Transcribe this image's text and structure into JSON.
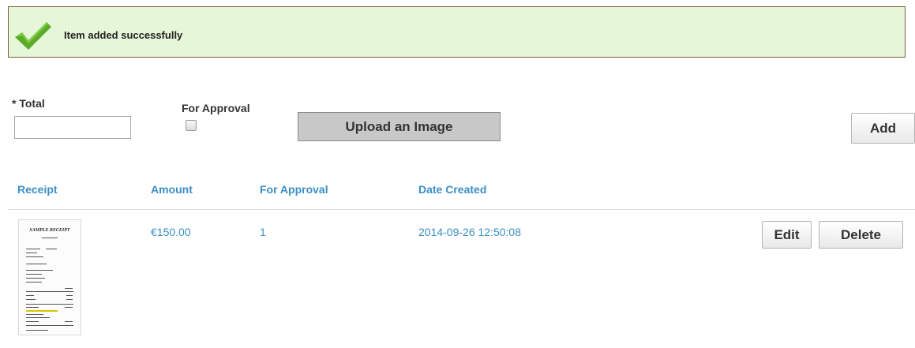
{
  "banner": {
    "message": "Item added successfully",
    "icon": "check-icon"
  },
  "form": {
    "total_label": "* Total",
    "total_value": "",
    "approval_label": "For Approval",
    "approval_checked": false,
    "upload_label": "Upload an Image",
    "add_label": "Add"
  },
  "table": {
    "headers": [
      "Receipt",
      "Amount",
      "For Approval",
      "Date Created"
    ],
    "rows": [
      {
        "receipt_title": "SAMPLE RECEIPT",
        "amount": "€150.00",
        "for_approval": "1",
        "date_created": "2014-09-26 12:50:08",
        "edit_label": "Edit",
        "delete_label": "Delete"
      }
    ]
  },
  "colors": {
    "banner_bg": "#e6f6d8",
    "banner_border": "#7a5a3c",
    "link_blue": "#3a8fc4",
    "check_green": "#5cab2b"
  }
}
